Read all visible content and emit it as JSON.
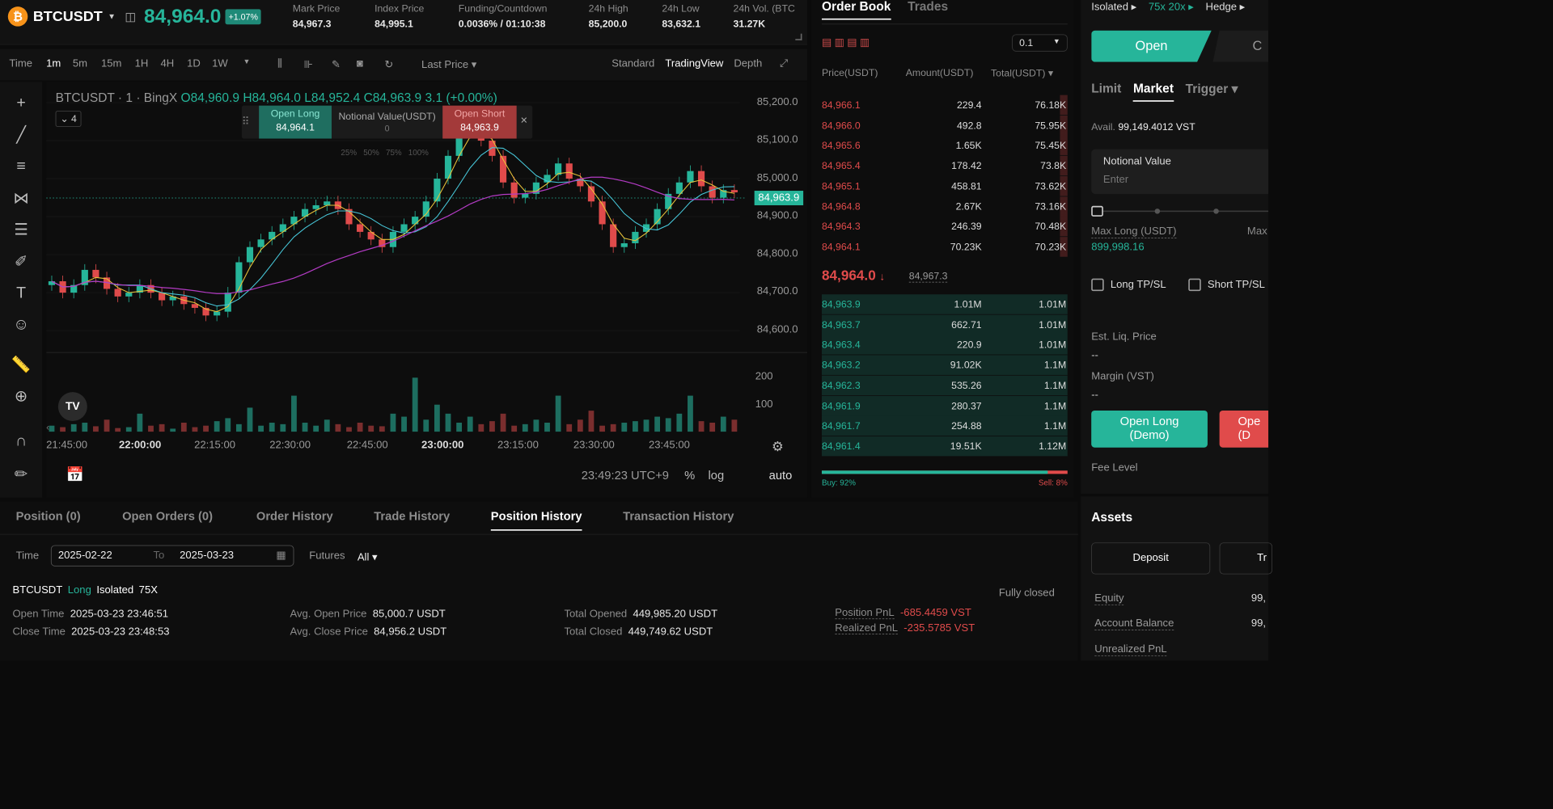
{
  "header": {
    "symbol": "BTCUSDT",
    "coin": "₿",
    "last_price": "84,964.0",
    "change": "+1.07%",
    "stats": [
      {
        "label": "Mark Price",
        "value": "84,967.3"
      },
      {
        "label": "Index Price",
        "value": "84,995.1"
      },
      {
        "label": "Funding/Countdown",
        "value": "0.0036% / 01:10:38"
      },
      {
        "label": "24h High",
        "value": "85,200.0"
      },
      {
        "label": "24h Low",
        "value": "83,632.1"
      },
      {
        "label": "24h Vol. (BTC",
        "value": "31.27K"
      }
    ]
  },
  "toolbar": {
    "time": "Time",
    "intervals": [
      "1m",
      "5m",
      "15m",
      "1H",
      "4H",
      "1D",
      "1W"
    ],
    "price_type": "Last Price",
    "views": [
      "Standard",
      "TradingView",
      "Depth"
    ]
  },
  "chart": {
    "legend_title": "BTCUSDT · 1 · BingX",
    "ohlc": "O84,960.9 H84,964.0 L84,952.4 C84,963.9 3.1 (+0.00%)",
    "indicator_count": "4",
    "quick": {
      "open_long_label": "Open Long",
      "open_long_price": "84,964.1",
      "notional_label": "Notional Value(USDT)",
      "notional_value": "0",
      "open_short_label": "Open Short",
      "open_short_price": "84,963.9",
      "percents": [
        "25%",
        "50%",
        "75%",
        "100%"
      ]
    },
    "price_tag": "84,963.9",
    "timestamp": "23:49:23 UTC+9",
    "scale_opts": [
      "%",
      "log",
      "auto"
    ],
    "logo": "TV"
  },
  "chart_data": {
    "type": "candlestick",
    "y_ticks": [
      "85,200.0",
      "85,100.0",
      "85,000.0",
      "84,900.0",
      "84,800.0",
      "84,700.0",
      "84,600.0"
    ],
    "volume_ticks": [
      "200",
      "100"
    ],
    "x_ticks": [
      "21:45:00",
      "22:00:00",
      "22:15:00",
      "22:30:00",
      "22:45:00",
      "23:00:00",
      "23:15:00",
      "23:30:00",
      "23:45:00"
    ],
    "closes": [
      84730,
      84700,
      84720,
      84760,
      84740,
      84710,
      84690,
      84700,
      84720,
      84700,
      84680,
      84690,
      84670,
      84660,
      84640,
      84650,
      84700,
      84780,
      84820,
      84840,
      84860,
      84880,
      84900,
      84920,
      84930,
      84940,
      84920,
      84880,
      84860,
      84840,
      84820,
      84860,
      84880,
      84900,
      84940,
      85000,
      85060,
      85120,
      85150,
      85100,
      85060,
      84990,
      84950,
      84960,
      84990,
      85010,
      85040,
      85000,
      84980,
      84940,
      84880,
      84820,
      84830,
      84860,
      84880,
      84920,
      84960,
      84990,
      85020,
      84980,
      84950,
      84970,
      84964
    ],
    "volumes": [
      20,
      15,
      25,
      30,
      18,
      40,
      12,
      15,
      60,
      20,
      25,
      10,
      30,
      15,
      20,
      35,
      45,
      25,
      80,
      20,
      30,
      25,
      120,
      30,
      20,
      40,
      25,
      15,
      30,
      20,
      18,
      60,
      50,
      180,
      40,
      90,
      60,
      30,
      50,
      25,
      35,
      60,
      20,
      25,
      40,
      30,
      120,
      25,
      40,
      70,
      20,
      25,
      30,
      35,
      40,
      50,
      45,
      60,
      120,
      35,
      30,
      50,
      40
    ]
  },
  "orderbook": {
    "tabs": [
      "Order Book",
      "Trades"
    ],
    "precision": "0.1",
    "headers": [
      "Price(USDT)",
      "Amount(USDT)",
      "Total(USDT)"
    ],
    "asks": [
      [
        "84,966.1",
        "229.4",
        "76.18K"
      ],
      [
        "84,966.0",
        "492.8",
        "75.95K"
      ],
      [
        "84,965.6",
        "1.65K",
        "75.45K"
      ],
      [
        "84,965.4",
        "178.42",
        "73.8K"
      ],
      [
        "84,965.1",
        "458.81",
        "73.62K"
      ],
      [
        "84,964.8",
        "2.67K",
        "73.16K"
      ],
      [
        "84,964.3",
        "246.39",
        "70.48K"
      ],
      [
        "84,964.1",
        "70.23K",
        "70.23K"
      ]
    ],
    "last": "84,964.0",
    "mark": "84,967.3",
    "bids": [
      [
        "84,963.9",
        "1.01M",
        "1.01M"
      ],
      [
        "84,963.7",
        "662.71",
        "1.01M"
      ],
      [
        "84,963.4",
        "220.9",
        "1.01M"
      ],
      [
        "84,963.2",
        "91.02K",
        "1.1M"
      ],
      [
        "84,962.3",
        "535.26",
        "1.1M"
      ],
      [
        "84,961.9",
        "280.37",
        "1.1M"
      ],
      [
        "84,961.7",
        "254.88",
        "1.1M"
      ],
      [
        "84,961.4",
        "19.51K",
        "1.12M"
      ]
    ],
    "buy": "Buy: 92%",
    "sell": "Sell: 8%",
    "buy_ratio": 0.92
  },
  "panel": {
    "margin_mode": "Isolated",
    "leverage": "75x 20x",
    "position_mode": "Hedge",
    "open_tab": "Open",
    "close_tab": "C",
    "order_types": [
      "Limit",
      "Market",
      "Trigger"
    ],
    "avail_label": "Avail.",
    "avail_value": "99,149.4012 VST",
    "notional_label": "Notional Value",
    "notional_placeholder": "Enter",
    "max_long_label": "Max Long (USDT)",
    "max_long_value": "899,998.16",
    "max_short_label": "Max",
    "long_tpsl": "Long TP/SL",
    "short_tpsl": "Short TP/SL",
    "liq_label": "Est. Liq. Price",
    "liq_value": "--",
    "margin_label": "Margin (VST)",
    "margin_value": "--",
    "open_long_btn": "Open Long (Demo)",
    "open_short_btn": "Ope (D",
    "fee_label": "Fee Level",
    "assets_title": "Assets",
    "deposit": "Deposit",
    "transfer": "Tr",
    "equity_label": "Equity",
    "equity_value": "99,",
    "balance_label": "Account Balance",
    "balance_value": "99,",
    "upnl_label": "Unrealized PnL"
  },
  "bottom": {
    "tabs": [
      "Position (0)",
      "Open Orders (0)",
      "Order History",
      "Trade History",
      "Position History",
      "Transaction History"
    ],
    "time_label": "Time",
    "date_from": "2025-02-22",
    "to_label": "To",
    "date_to": "2025-03-23",
    "futures_label": "Futures",
    "futures_value": "All",
    "pos": {
      "symbol": "BTCUSDT",
      "side": "Long",
      "mode": "Isolated",
      "lev": "75X",
      "status": "Fully closed",
      "open_time_label": "Open Time",
      "open_time": "2025-03-23 23:46:51",
      "close_time_label": "Close Time",
      "close_time": "2025-03-23 23:48:53",
      "avg_open_label": "Avg. Open Price",
      "avg_open": "85,000.7  USDT",
      "avg_close_label": "Avg. Close Price",
      "avg_close": "84,956.2  USDT",
      "tot_open_label": "Total Opened",
      "tot_open": "449,985.20  USDT",
      "tot_closed_label": "Total Closed",
      "tot_closed": "449,749.62  USDT",
      "pnl_label": "Position PnL",
      "pnl": "-685.4459 VST",
      "rpnl_label": "Realized PnL",
      "rpnl": "-235.5785 VST"
    }
  }
}
